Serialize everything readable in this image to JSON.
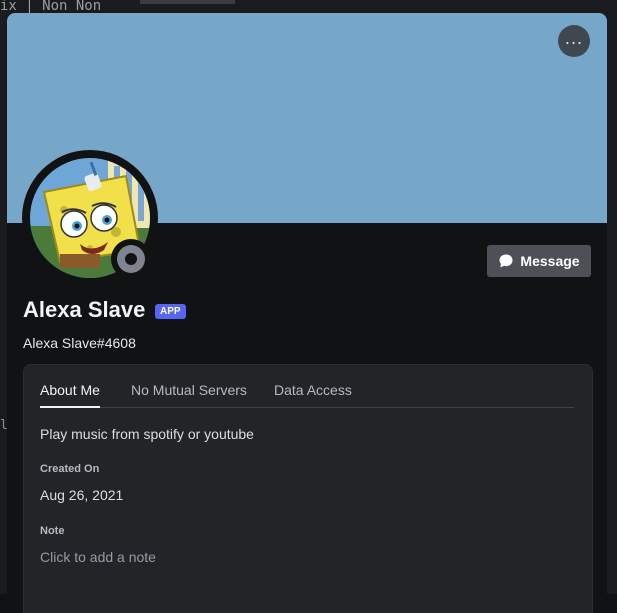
{
  "background": {
    "partial_text": "ix | Non Non"
  },
  "profile": {
    "display_name": "Alexa Slave",
    "badge": "APP",
    "tag": "Alexa Slave#4608",
    "banner_color": "#76a7c8",
    "status": "offline"
  },
  "actions": {
    "message_label": "Message",
    "more_label": "..."
  },
  "tabs": [
    {
      "label": "About Me",
      "active": true
    },
    {
      "label": "No Mutual Servers",
      "active": false
    },
    {
      "label": "Data Access",
      "active": false
    }
  ],
  "about": {
    "text": "Play music from spotify or youtube"
  },
  "created": {
    "label": "Created On",
    "value": "Aug 26, 2021"
  },
  "note": {
    "label": "Note",
    "placeholder": "Click to add a note"
  },
  "colors": {
    "accent": "#5865f2",
    "panel": "#232428",
    "surface": "#111214"
  }
}
